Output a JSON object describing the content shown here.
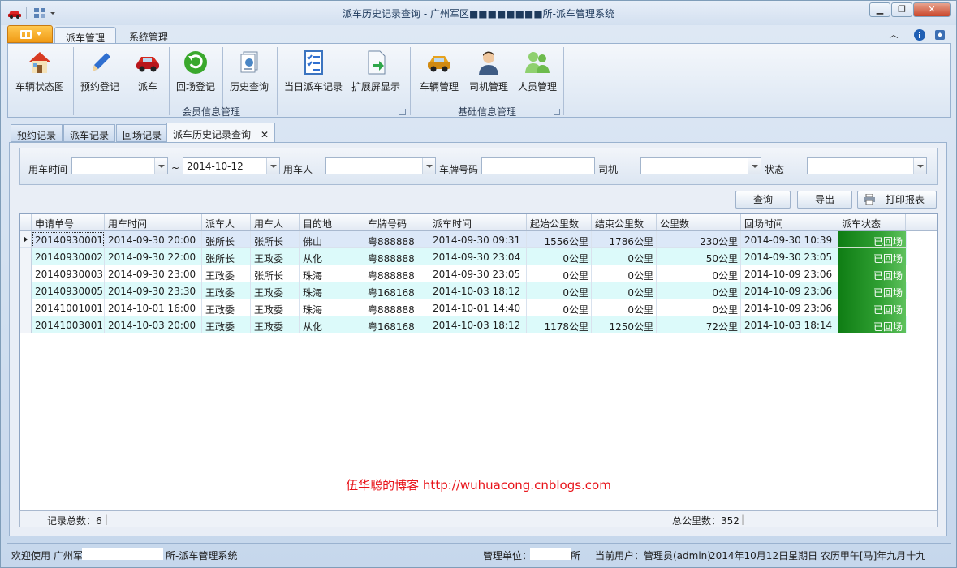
{
  "window": {
    "title": "派车历史记录查询 - 广州军区■■■■■■■■所-派车管理系统"
  },
  "ribbon_tabs": [
    "派车管理",
    "系统管理"
  ],
  "ribbon": {
    "group1_label": "会员信息管理",
    "group2_label": "基础信息管理",
    "buttons": [
      {
        "label": "车辆状态图",
        "icon": "house-icon"
      },
      {
        "label": "预约登记",
        "icon": "pencil-icon"
      },
      {
        "label": "派车",
        "icon": "red-car-icon"
      },
      {
        "label": "回场登记",
        "icon": "green-refresh-icon"
      },
      {
        "label": "历史查询",
        "icon": "history-documents-icon"
      },
      {
        "label": "当日派车记录",
        "icon": "checklist-icon"
      },
      {
        "label": "扩展屏显示",
        "icon": "document-arrow-icon"
      },
      {
        "label": "车辆管理",
        "icon": "yellow-car-icon"
      },
      {
        "label": "司机管理",
        "icon": "driver-person-icon"
      },
      {
        "label": "人员管理",
        "icon": "people-group-icon"
      }
    ]
  },
  "doc_tabs": [
    "预约记录",
    "派车记录",
    "回场记录",
    "派车历史记录查询"
  ],
  "filter": {
    "date_label": "用车时间",
    "date_from": "",
    "tilde": "~",
    "date_to": "2014-10-12",
    "user_label": "用车人",
    "user_value": "",
    "plate_label": "车牌号码",
    "plate_value": "",
    "driver_label": "司机",
    "driver_value": "",
    "status_label": "状态",
    "status_value": ""
  },
  "actions": {
    "query": "查询",
    "export": "导出",
    "print": "打印报表"
  },
  "grid": {
    "columns": [
      "申请单号",
      "用车时间",
      "派车人",
      "用车人",
      "目的地",
      "车牌号码",
      "派车时间",
      "起始公里数",
      "结束公里数",
      "公里数",
      "回场时间",
      "派车状态"
    ],
    "rows": [
      [
        "20140930001",
        "2014-09-30 20:00",
        "张所长",
        "张所长",
        "佛山",
        "粤888888",
        "2014-09-30 09:31",
        "1556公里",
        "1786公里",
        "230公里",
        "2014-09-30 10:39",
        "已回场"
      ],
      [
        "20140930002",
        "2014-09-30 22:00",
        "张所长",
        "王政委",
        "从化",
        "粤888888",
        "2014-09-30 23:04",
        "0公里",
        "0公里",
        "50公里",
        "2014-09-30 23:05",
        "已回场"
      ],
      [
        "20140930003",
        "2014-09-30 23:00",
        "王政委",
        "张所长",
        "珠海",
        "粤888888",
        "2014-09-30 23:05",
        "0公里",
        "0公里",
        "0公里",
        "2014-10-09 23:06",
        "已回场"
      ],
      [
        "20140930005",
        "2014-09-30 23:30",
        "王政委",
        "王政委",
        "珠海",
        "粤168168",
        "2014-10-03 18:12",
        "0公里",
        "0公里",
        "0公里",
        "2014-10-09 23:06",
        "已回场"
      ],
      [
        "20141001001",
        "2014-10-01 16:00",
        "王政委",
        "王政委",
        "珠海",
        "粤888888",
        "2014-10-01 14:40",
        "0公里",
        "0公里",
        "0公里",
        "2014-10-09 23:06",
        "已回场"
      ],
      [
        "20141003001",
        "2014-10-03 20:00",
        "王政委",
        "王政委",
        "从化",
        "粤168168",
        "2014-10-03 18:12",
        "1178公里",
        "1250公里",
        "72公里",
        "2014-10-03 18:14",
        "已回场"
      ]
    ],
    "footer_count": "记录总数：6",
    "footer_total": "总公里数：352"
  },
  "watermark": "伍华聪的博客 http://wuhuacong.cnblogs.com",
  "statusbar": {
    "welcome": "欢迎使用 广州军",
    "welcome_suffix": "所-派车管理系统",
    "unit_label": "管理单位：",
    "unit_suffix": "所",
    "user": "当前用户：管理员(admin)",
    "date": "2014年10月12日星期日 农历甲午[马]年九月十九"
  }
}
